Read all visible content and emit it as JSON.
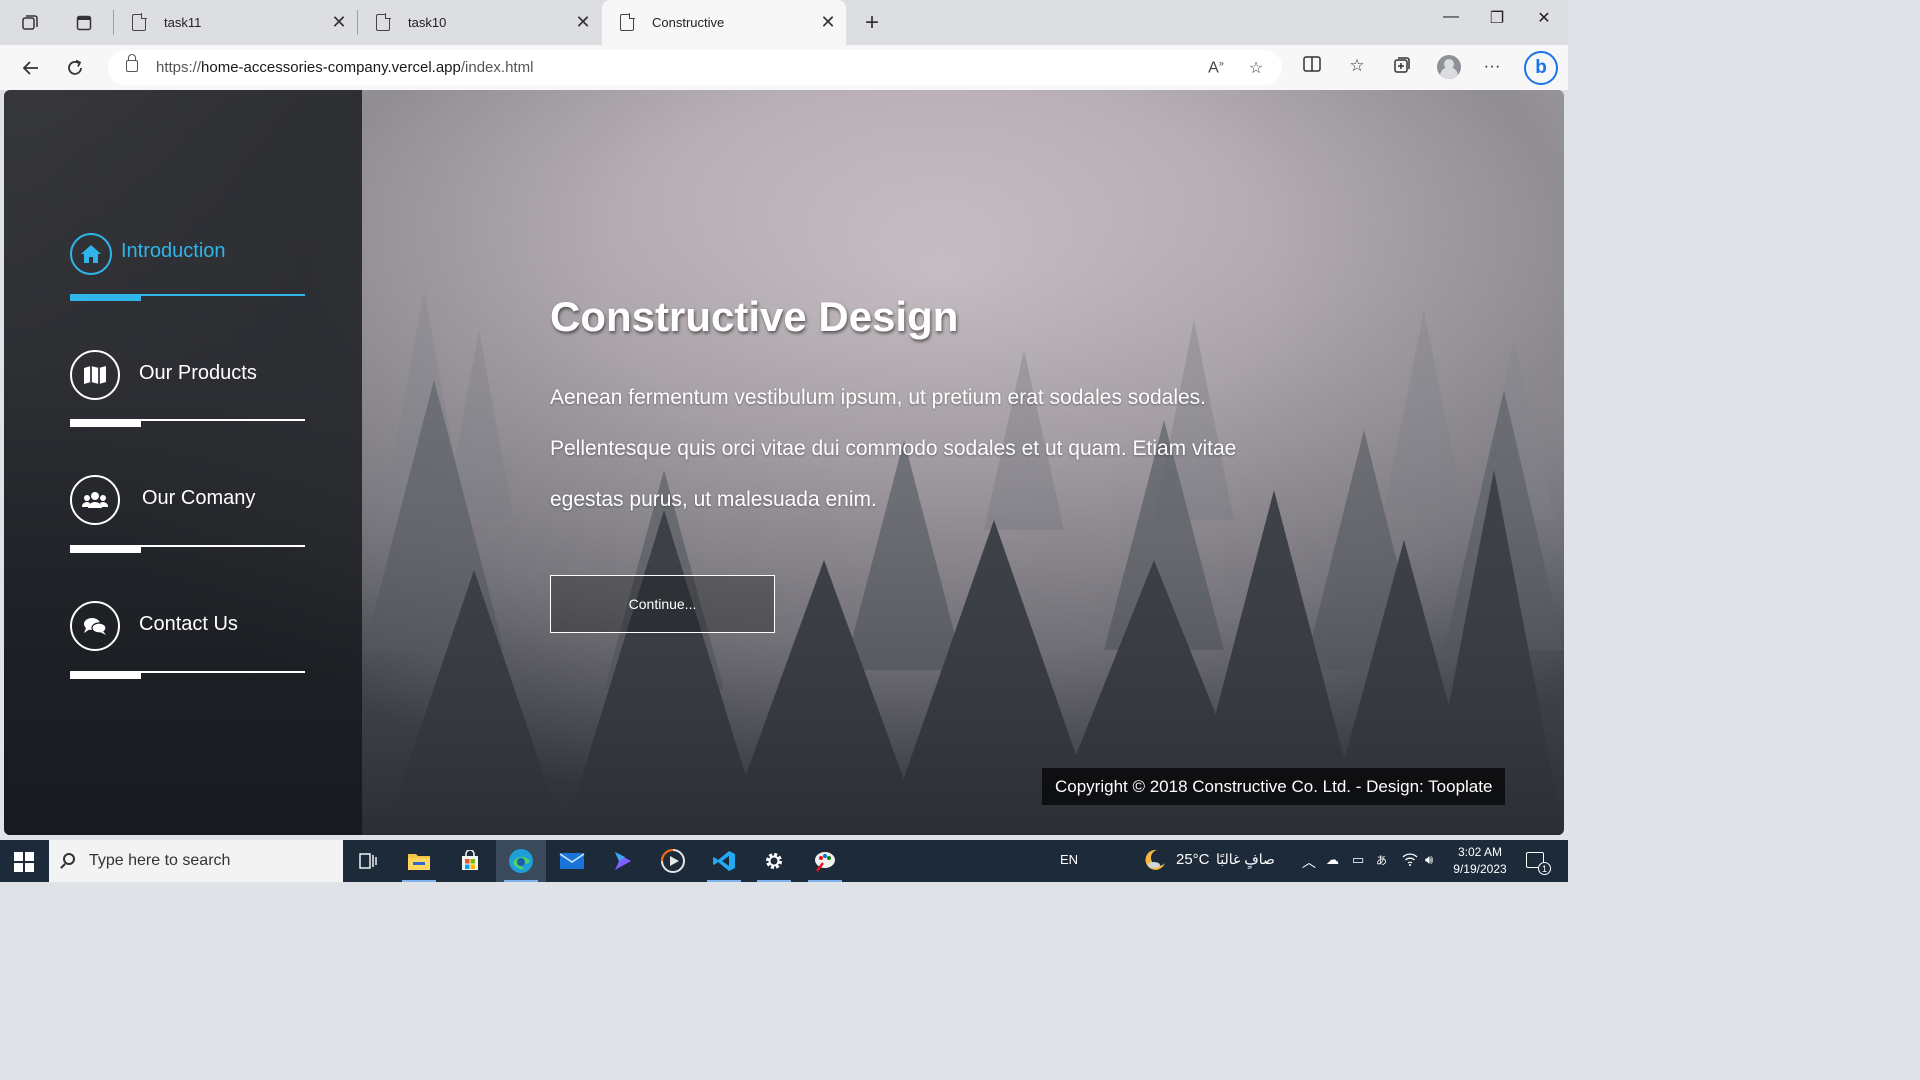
{
  "browser": {
    "tabs": [
      {
        "title": "task11"
      },
      {
        "title": "task10"
      },
      {
        "title": "Constructive"
      }
    ],
    "address": {
      "scheme": "https://",
      "host": "home-accessories-company.vercel.app",
      "path": "/index.html"
    }
  },
  "sidebar": {
    "items": [
      {
        "label": "Introduction",
        "icon": "home-icon",
        "active": true
      },
      {
        "label": "Our Products",
        "icon": "map-icon",
        "active": false
      },
      {
        "label": "Our Comany",
        "icon": "users-icon",
        "active": false
      },
      {
        "label": "Contact Us",
        "icon": "comments-icon",
        "active": false
      }
    ]
  },
  "hero": {
    "title": "Constructive Design",
    "text": "Aenean fermentum vestibulum ipsum, ut pretium erat sodales sodales. Pellentesque quis orci vitae dui commodo sodales et ut quam. Etiam vitae egestas purus, ut malesuada enim.",
    "button_label": "Continue..."
  },
  "footer": {
    "copyright": "Copyright © 2018 Constructive Co. Ltd. - Design: Tooplate"
  },
  "taskbar": {
    "search_placeholder": "Type here to search",
    "language": "EN",
    "weather_temp": "25°C",
    "weather_text": "صافٍ غالبًا",
    "time": "3:02 AM",
    "date": "9/19/2023",
    "notification_count": "1"
  },
  "colors": {
    "accent": "#2fb5ea",
    "sidebar_bg": "#121418",
    "taskbar_bg": "#1c2a3a"
  }
}
